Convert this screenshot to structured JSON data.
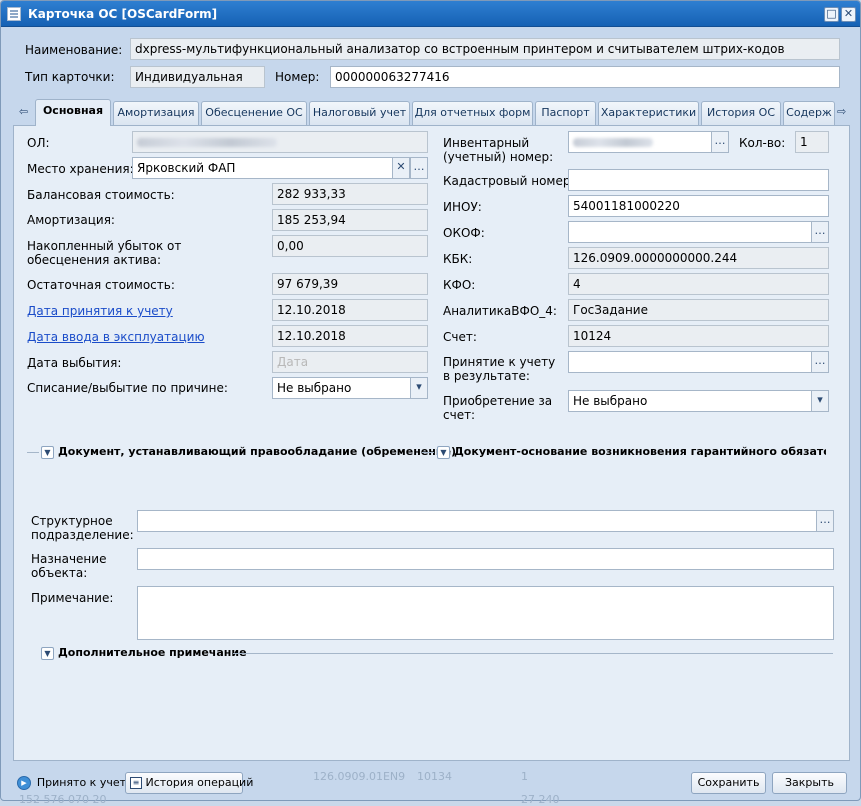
{
  "window": {
    "title": "Карточка ОС [OSCardForm]"
  },
  "header": {
    "name_label": "Наименование:",
    "name_value": "dxpress-мультифункциональный анализатор со встроенным принтером и считывателем штрих-кодов",
    "type_label": "Тип карточки:",
    "type_value": "Индивидуальная",
    "number_label": "Номер:",
    "number_value": "000000063277416"
  },
  "tabs": [
    "Основная",
    "Амортизация",
    "Обесценение ОС",
    "Налоговый учет",
    "Для отчетных форм",
    "Паспорт",
    "Характеристики",
    "История ОС",
    "Содерж"
  ],
  "left": {
    "ol_label": "ОЛ:",
    "storage_label": "Место хранения:",
    "storage_value": "Ярковский ФАП",
    "balance_label": "Балансовая стоимость:",
    "balance_value": "282 933,33",
    "amort_label": "Амортизация:",
    "amort_value": "185 253,94",
    "loss_label": "Накопленный убыток от обесценения актива:",
    "loss_value": "0,00",
    "residual_label": "Остаточная стоимость:",
    "residual_value": "97 679,39",
    "accept_label": "Дата принятия к учету",
    "accept_value": "12.10.2018",
    "exploit_label": "Дата ввода в эксплуатацию",
    "exploit_value": "12.10.2018",
    "disposal_label": "Дата выбытия:",
    "disposal_placeholder": "Дата",
    "writeoff_label": "Списание/выбытие по причине:",
    "writeoff_value": "Не выбрано"
  },
  "right": {
    "inv_label": "Инвентарный (учетный) номер:",
    "qty_label": "Кол-во:",
    "qty_value": "1",
    "cadastral_label": "Кадастровый номер:",
    "inou_label": "ИНОУ:",
    "inou_value": "54001181000220",
    "okof_label": "ОКОФ:",
    "kbk_label": "КБК:",
    "kbk_value": "126.0909.0000000000.244",
    "kfo_label": "КФО:",
    "kfo_value": "4",
    "analytics_label": "АналитикаВФО_4:",
    "analytics_value": "ГосЗадание",
    "account_label": "Счет:",
    "account_value": "10124",
    "accept_result_label": "Принятие к учету в результате:",
    "acquisition_label": "Приобретение за счет:",
    "acquisition_value": "Не выбрано"
  },
  "sections": {
    "rights_doc": "Документ, устанавливающий правообладание (обременение)",
    "warranty_doc": "Документ-основание возникновения гарантийного обязательст",
    "extra_note": "Дополнительное примечание"
  },
  "bottom": {
    "struct_label": "Структурное подразделение:",
    "purpose_label": "Назначение объекта:",
    "note_label": "Примечание:"
  },
  "footer": {
    "accepted_label": "Принято к учету",
    "history_label": "История операций",
    "save_label": "Сохранить",
    "close_label": "Закрыть"
  },
  "background_peek": {
    "kbk": "126.0909.01EN9",
    "acc": "10134",
    "qty": "1",
    "amount": "152 576 070 20",
    "amount2": "27 240"
  }
}
